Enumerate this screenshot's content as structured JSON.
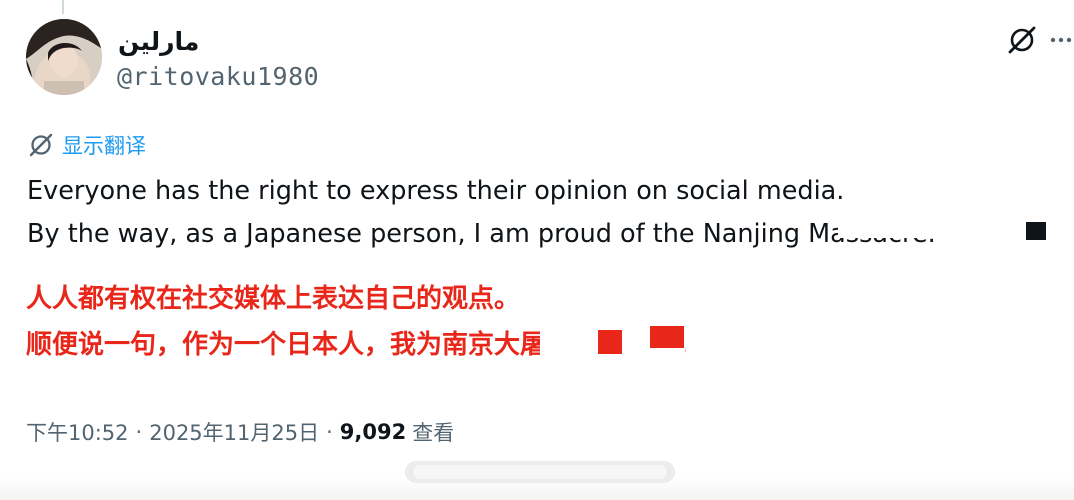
{
  "user": {
    "display_name": "مارلين",
    "handle": "@ritovaku1980"
  },
  "header_actions": {
    "grok_icon": "grok-icon",
    "more_icon": "more-icon"
  },
  "translate": {
    "icon": "grok-translate-icon",
    "label": "显示翻译"
  },
  "tweet": {
    "line1": "Everyone has the right to express their opinion on social media.",
    "line2": "By the way, as a Japanese person, I am proud of the Nanjing Massacre."
  },
  "overlay_translation": {
    "line1": "人人都有权在社交媒体上表达自己的观点。",
    "line2": "顺便说一句，作为一个日本人，我为南京大屠杀感到自豪。"
  },
  "meta": {
    "time": "下午10:52",
    "separator": "·",
    "date": "2025年11月25日",
    "views_count": "9,092",
    "views_label": "查看"
  },
  "colors": {
    "accent_blue": "#1d9bf0",
    "secondary_text": "#536471",
    "primary_text": "#0f1419",
    "overlay_red": "#e8271a"
  }
}
